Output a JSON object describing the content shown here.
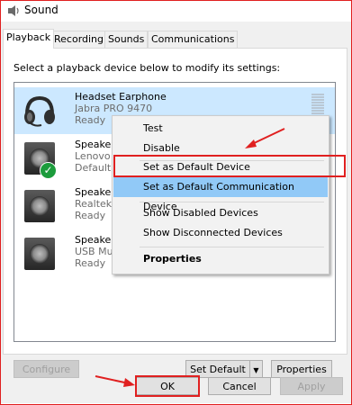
{
  "window": {
    "title": "Sound",
    "icon": "speaker-icon"
  },
  "tabs": [
    {
      "label": "Playback",
      "active": true
    },
    {
      "label": "Recording"
    },
    {
      "label": "Sounds"
    },
    {
      "label": "Communications"
    }
  ],
  "instruction": "Select a playback device below to modify its settings:",
  "devices": [
    {
      "name": "Headset Earphone",
      "desc": "Jabra PRO 9470",
      "status": "Ready",
      "icon": "headset-icon",
      "selected": true
    },
    {
      "name": "Speakers",
      "desc": "Lenovo A",
      "status": "Default D",
      "icon": "speaker-icon",
      "badge": "green-check-icon"
    },
    {
      "name": "Speaker/",
      "desc": "Realtek H",
      "status": "Ready",
      "icon": "speaker-icon"
    },
    {
      "name": "Speakers",
      "desc": "USB Mul",
      "status": "Ready",
      "icon": "speaker-icon"
    }
  ],
  "context_menu": {
    "items": [
      {
        "label": "Test"
      },
      {
        "label": "Disable"
      },
      {
        "label": "Set as Default Device",
        "annotated": true
      },
      {
        "label": "Set as Default Communication Device",
        "highlighted": true
      },
      {
        "label": "Show Disabled Devices"
      },
      {
        "label": "Show Disconnected Devices"
      },
      {
        "label": "Properties",
        "bold": true
      }
    ]
  },
  "buttons": {
    "configure": "Configure",
    "set_default": "Set Default",
    "properties": "Properties",
    "ok": "OK",
    "cancel": "Cancel",
    "apply": "Apply"
  },
  "colors": {
    "annotation_red": "#e02020",
    "selection": "#cce8ff",
    "menu_highlight": "#91c9f7",
    "check_green": "#1c9c3c"
  }
}
